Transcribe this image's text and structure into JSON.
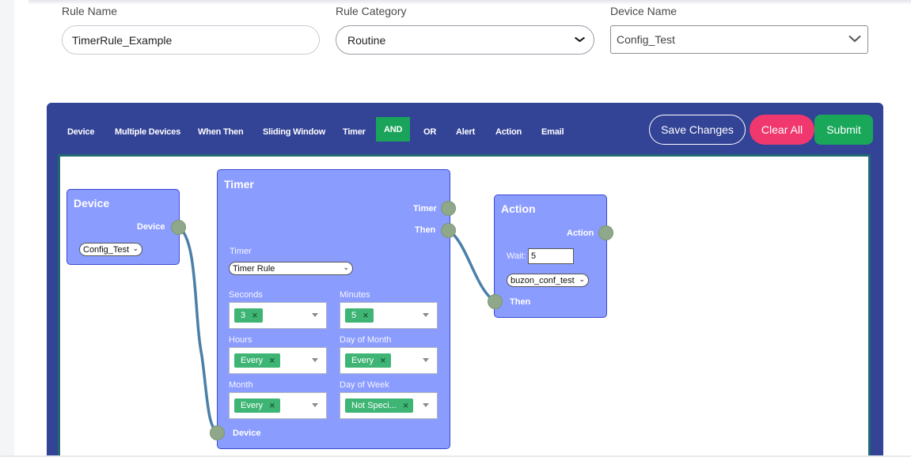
{
  "form": {
    "rule_name_label": "Rule Name",
    "rule_name_value": "TimerRule_Example",
    "rule_category_label": "Rule Category",
    "rule_category_value": "Routine",
    "device_name_label": "Device Name",
    "device_name_value": "Config_Test"
  },
  "toolbar": {
    "items": [
      "Device",
      "Multiple Devices",
      "When Then",
      "Sliding Window",
      "Timer",
      "AND",
      "OR",
      "Alert",
      "Action",
      "Email"
    ],
    "active_item": "AND",
    "save_label": "Save Changes",
    "clear_label": "Clear All",
    "submit_label": "Submit"
  },
  "nodes": {
    "device": {
      "title": "Device",
      "output_label": "Device",
      "select_value": "Config_Test"
    },
    "timer": {
      "title": "Timer",
      "output_timer_label": "Timer",
      "output_then_label": "Then",
      "input_device_label": "Device",
      "timer_label": "Timer",
      "timer_select_value": "Timer Rule",
      "seconds_label": "Seconds",
      "seconds_tag": "3",
      "minutes_label": "Minutes",
      "minutes_tag": "5",
      "hours_label": "Hours",
      "hours_tag": "Every",
      "day_of_month_label": "Day of Month",
      "day_of_month_tag": "Every",
      "month_label": "Month",
      "month_tag": "Every",
      "day_of_week_label": "Day of Week",
      "day_of_week_tag": "Not Speci..."
    },
    "action": {
      "title": "Action",
      "output_label": "Action",
      "wait_label": "Wait:",
      "wait_value": "5",
      "select_value": "buzon_conf_test",
      "input_then_label": "Then"
    }
  },
  "colors": {
    "editor_bg": "#334396",
    "node_bg": "#8b9cff",
    "active_tab": "#1aa35a",
    "clear_button": "#f0386f",
    "submit_button": "#19a859",
    "connection": "#4a7fa8"
  },
  "icons": {
    "tag_remove": "×",
    "select_chevron": "chevron-down-icon"
  }
}
